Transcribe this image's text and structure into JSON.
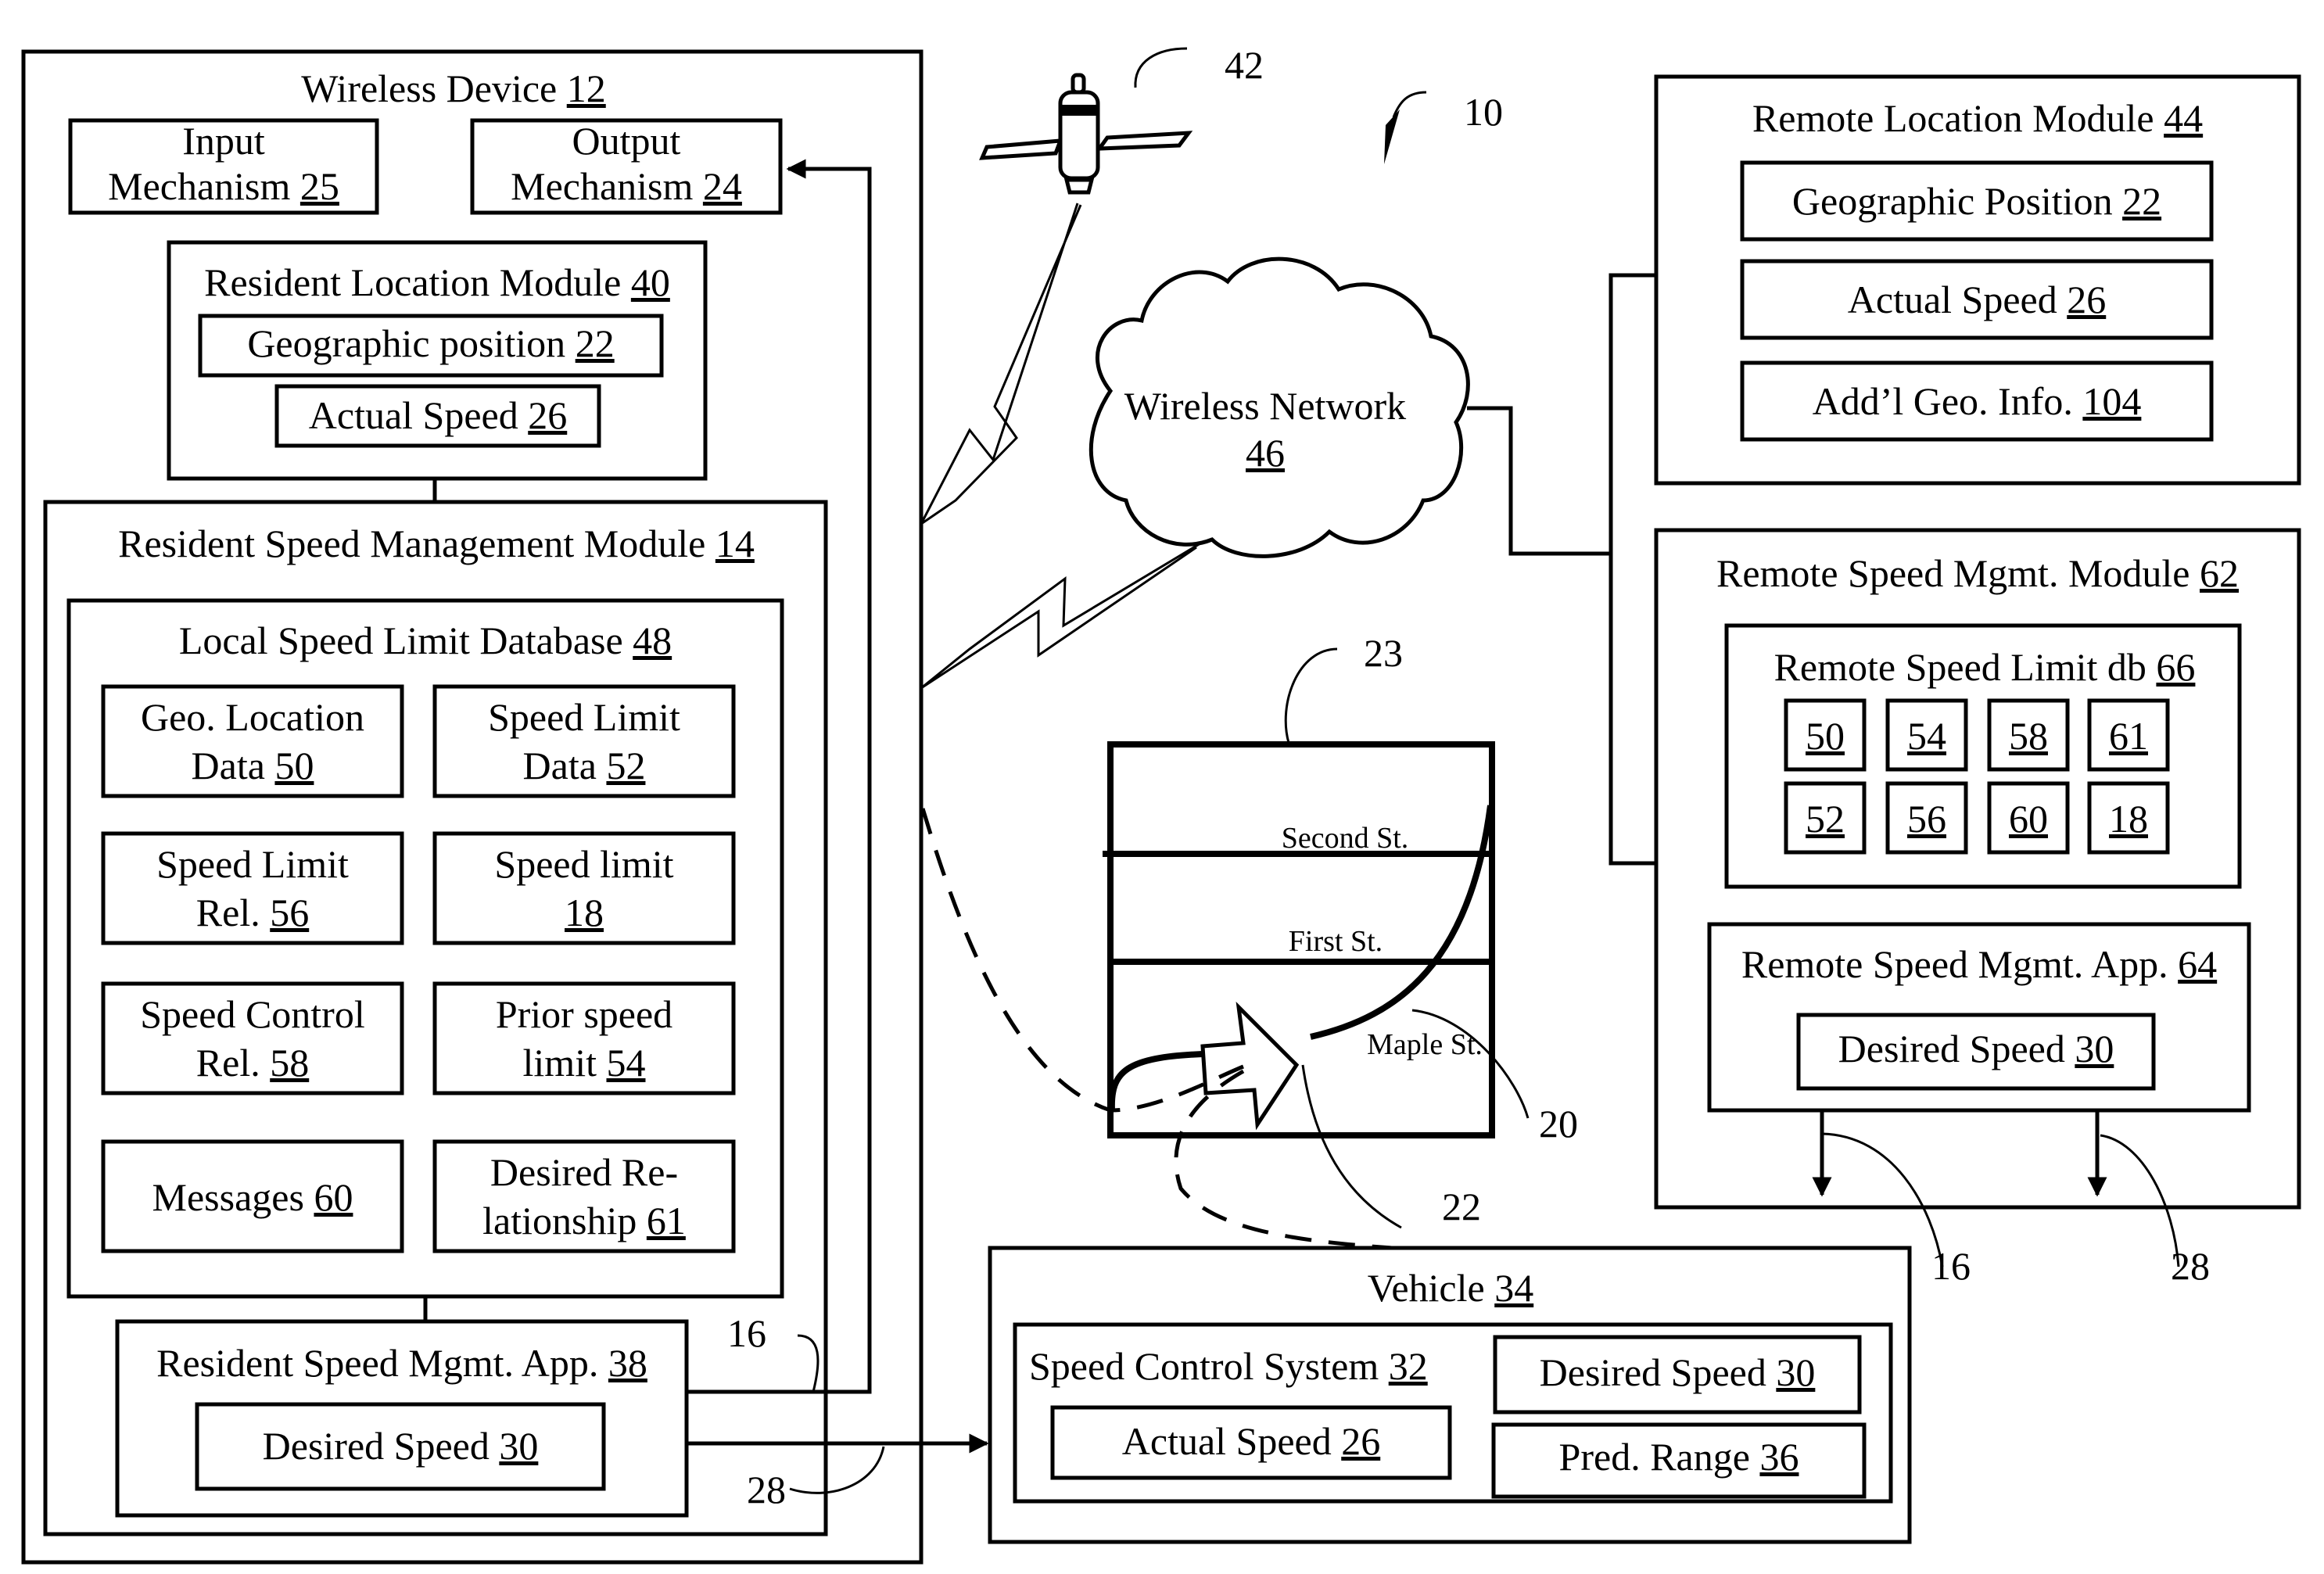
{
  "figure_ref": "10",
  "wireless_device": {
    "title": "Wireless Device",
    "num": "12",
    "input_mechanism": {
      "line1": "Input",
      "line2": "Mechanism",
      "num": "25"
    },
    "output_mechanism": {
      "line1": "Output",
      "line2": "Mechanism",
      "num": "24"
    },
    "resident_location_module": {
      "title": "Resident Location Module",
      "num": "40",
      "geo_position": {
        "label": "Geographic position",
        "num": "22"
      },
      "actual_speed": {
        "label": "Actual Speed",
        "num": "26"
      }
    },
    "resident_speed_mgmt_module": {
      "title": "Resident Speed Management Module",
      "num": "14",
      "local_db": {
        "title": "Local Speed Limit Database",
        "num": "48",
        "items": [
          {
            "line1": "Geo. Location",
            "line2": "Data",
            "num": "50"
          },
          {
            "line1": "Speed Limit",
            "line2": "Data",
            "num": "52"
          },
          {
            "line1": "Speed Limit",
            "line2": "Rel.",
            "num": "56"
          },
          {
            "line1": "Speed limit",
            "line2": "",
            "num": "18"
          },
          {
            "line1": "Speed Control",
            "line2": "Rel.",
            "num": "58"
          },
          {
            "line1": "Prior speed",
            "line2": "limit",
            "num": "54"
          },
          {
            "line1": "",
            "line2": "Messages",
            "num": "60"
          },
          {
            "line1": "Desired Re-",
            "line2": "lationship",
            "num": "61"
          }
        ]
      },
      "app": {
        "title": "Resident Speed Mgmt. App.",
        "num": "38",
        "desired_speed": {
          "label": "Desired Speed",
          "num": "30"
        }
      }
    }
  },
  "satellite": {
    "num": "42"
  },
  "wireless_network": {
    "label": "Wireless Network",
    "num": "46"
  },
  "remote_location_module": {
    "title": "Remote Location Module",
    "num": "44",
    "items": [
      {
        "label": "Geographic Position",
        "num": "22"
      },
      {
        "label": "Actual Speed",
        "num": "26"
      },
      {
        "label": "Add’l Geo. Info. ",
        "num": "104"
      }
    ]
  },
  "remote_speed_mgmt_module": {
    "title": "Remote Speed Mgmt. Module",
    "num": "62",
    "db": {
      "title": "Remote Speed Limit db",
      "num": "66",
      "row1": [
        "50",
        "54",
        "58",
        "61"
      ],
      "row2": [
        "52",
        "56",
        "60",
        "18"
      ]
    },
    "app": {
      "title": "Remote Speed Mgmt. App.",
      "num": "64",
      "desired_speed": {
        "label": "Desired Speed",
        "num": "30"
      }
    }
  },
  "map": {
    "num": "23",
    "streets": [
      "Second St.",
      "First St.",
      "Maple St."
    ],
    "route_num": "20",
    "position_num": "22"
  },
  "vehicle": {
    "title": "Vehicle",
    "num": "34",
    "speed_control_system": {
      "title": "Speed Control System",
      "num": "32"
    },
    "desired_speed": {
      "label": "Desired Speed",
      "num": "30"
    },
    "actual_speed": {
      "label": "Actual Speed",
      "num": "26"
    },
    "pred_range": {
      "label": "Pred. Range",
      "num": "36"
    }
  },
  "signals": {
    "s16": "16",
    "s28": "28"
  }
}
